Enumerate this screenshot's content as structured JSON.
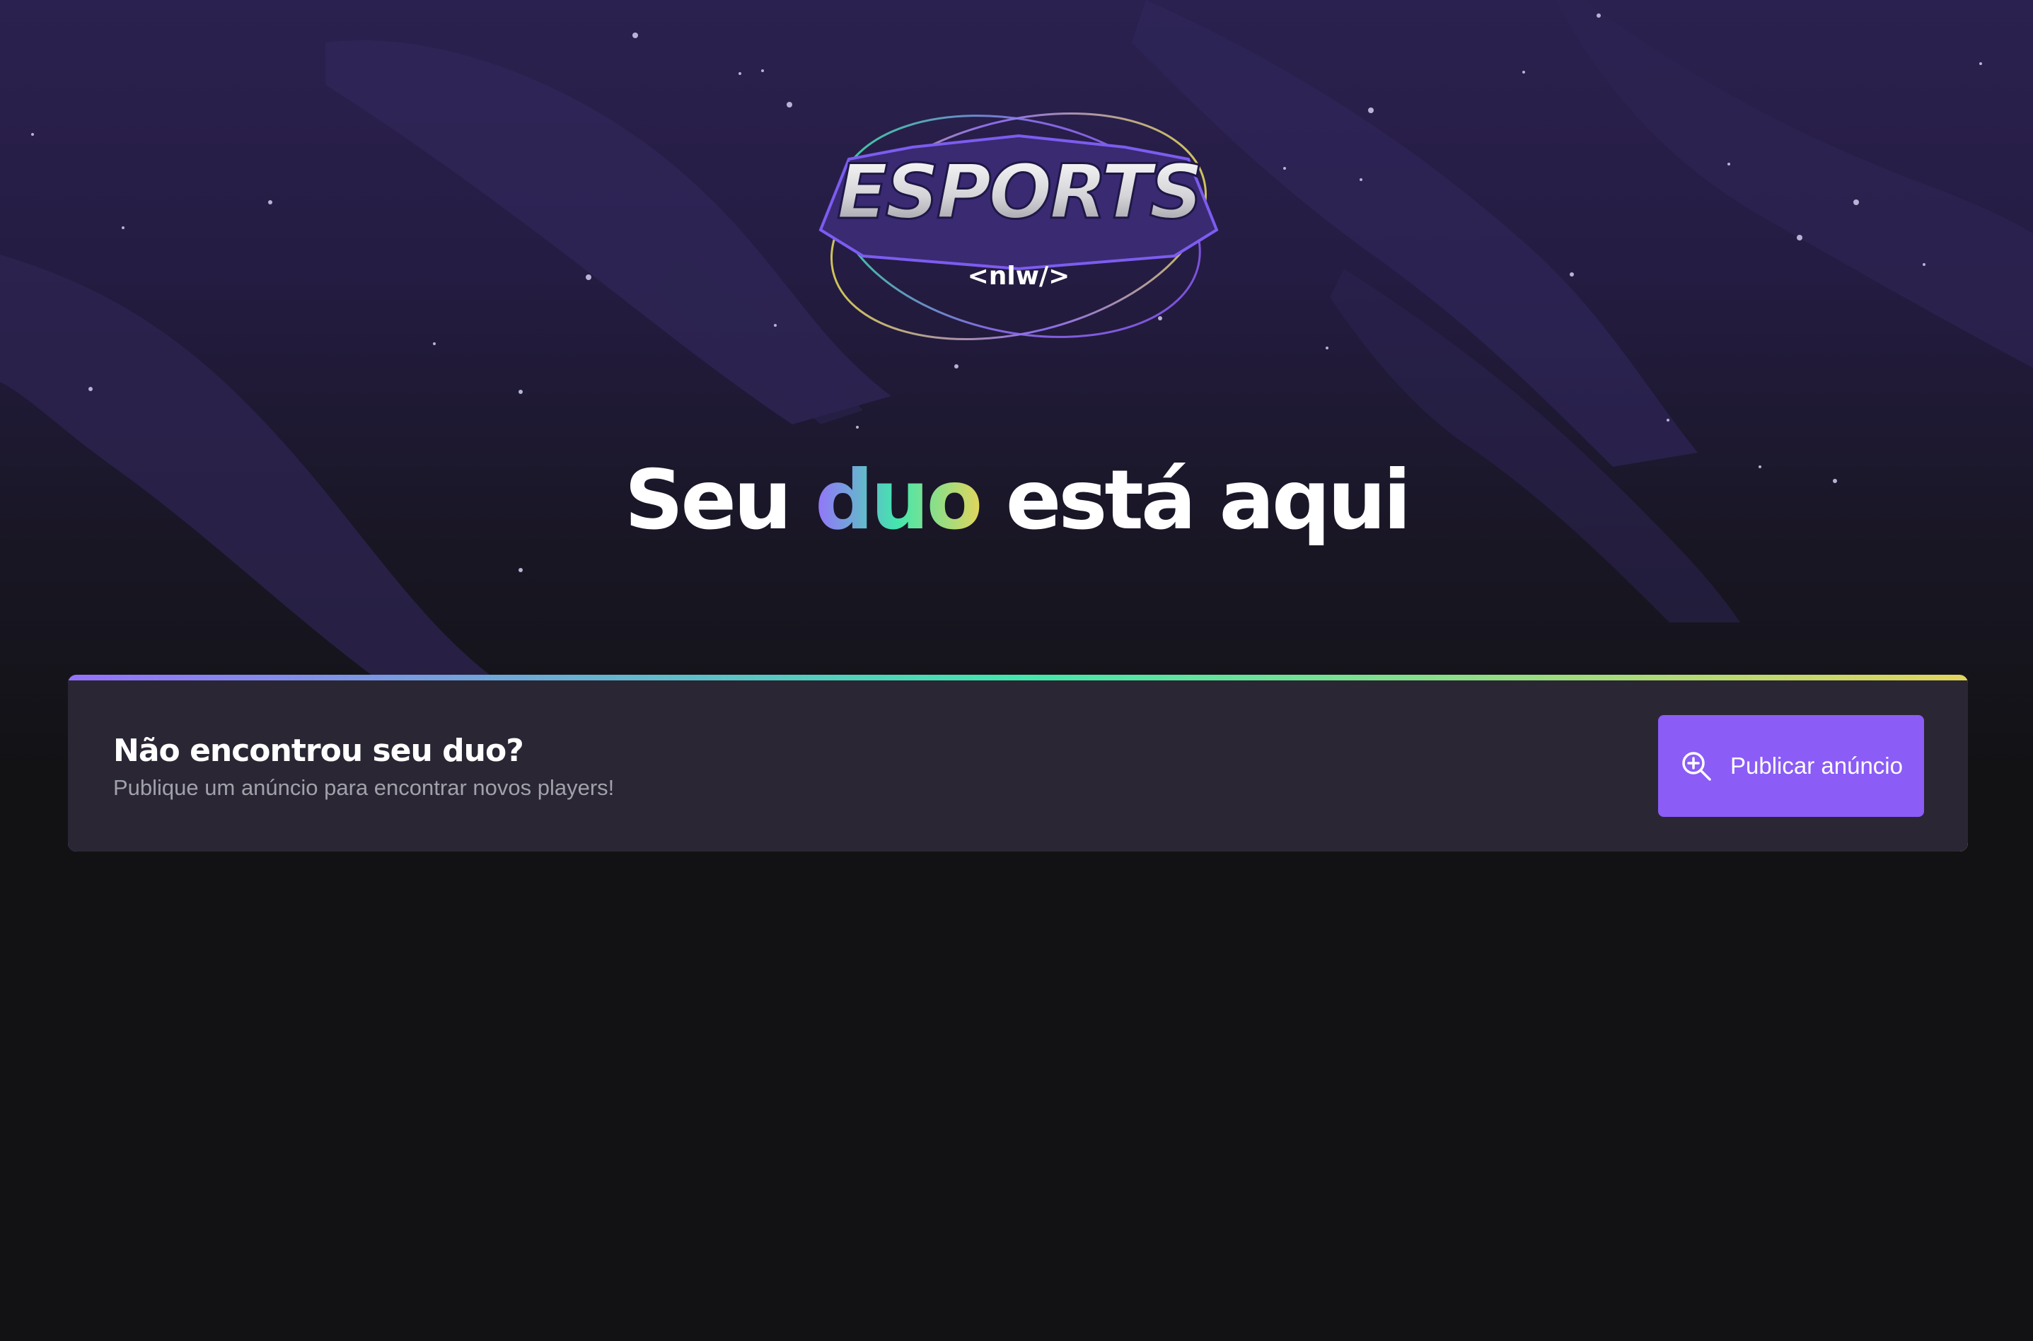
{
  "brand": {
    "logo_text": "ESPORTS",
    "logo_tag": "<nlw/>"
  },
  "hero": {
    "title_before": "Seu",
    "title_accent": "duo",
    "title_after": "está aqui"
  },
  "banner": {
    "title": "Não encontrou seu duo?",
    "subtitle": "Publique um anúncio para encontrar novos players!",
    "button_label": "Publicar anúncio",
    "button_icon": "magnifying-glass-plus-icon"
  },
  "colors": {
    "background": "#121214",
    "banner_bg": "#2a2634",
    "button": "#8b5cf6",
    "gradient": [
      "#9572fc",
      "#43e7ad",
      "#e1d55d"
    ]
  }
}
